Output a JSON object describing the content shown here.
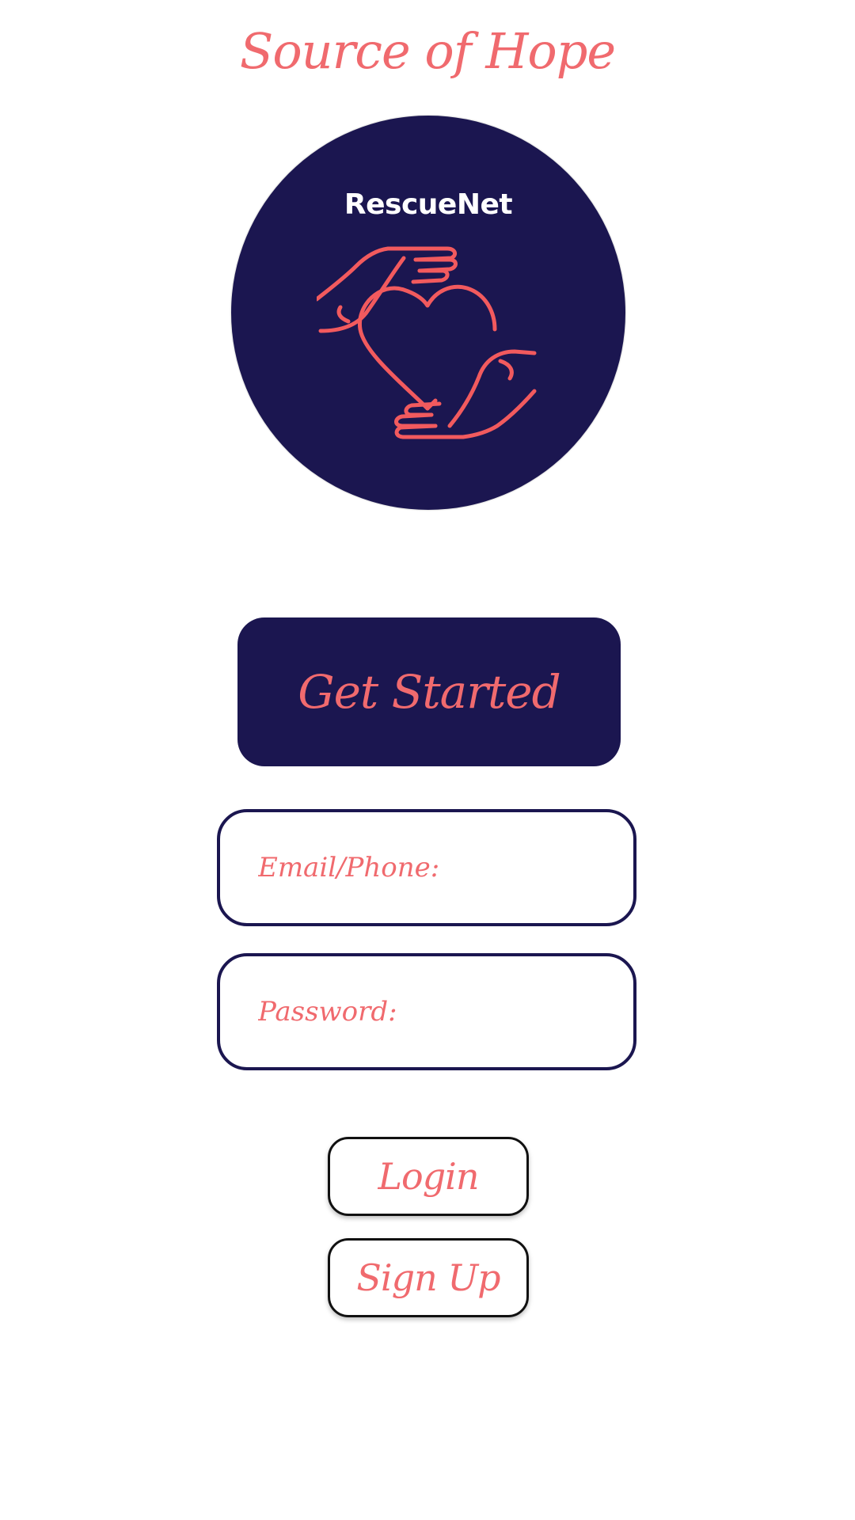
{
  "app": {
    "title": "Source of Hope"
  },
  "logo": {
    "text": "RescueNet",
    "icon": "hands-holding-heart-icon",
    "background_color": "#1b1650",
    "line_color": "#f25a5e"
  },
  "actions": {
    "get_started_label": "Get Started",
    "login_label": "Login",
    "signup_label": "Sign Up"
  },
  "form": {
    "email_placeholder": "Email/Phone:",
    "email_value": "",
    "password_placeholder": "Password:",
    "password_value": ""
  },
  "colors": {
    "accent": "#f06a6e",
    "brand": "#1b1650"
  }
}
